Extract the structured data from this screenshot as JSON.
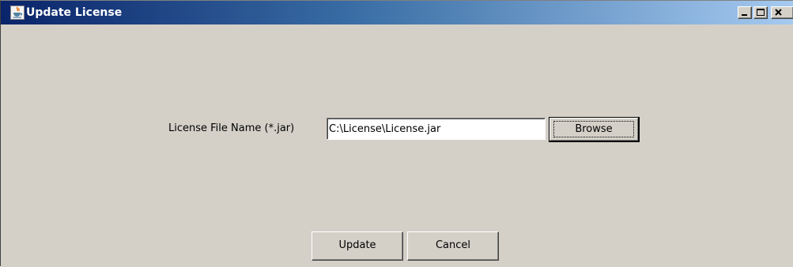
{
  "window": {
    "title": "Update License",
    "icon": "java-cup-icon",
    "controls": [
      "minimize-icon",
      "maximize-icon",
      "close-icon"
    ]
  },
  "form": {
    "field_label": "License File Name (*.jar)",
    "file_path_value": "C:\\License\\License.jar",
    "browse_label": "Browse"
  },
  "actions": {
    "update_label": "Update",
    "cancel_label": "Cancel"
  },
  "colors": {
    "title_gradient_start": "#0a246a",
    "title_gradient_end": "#a6caf0",
    "dialog_background": "#d4d0c8"
  }
}
